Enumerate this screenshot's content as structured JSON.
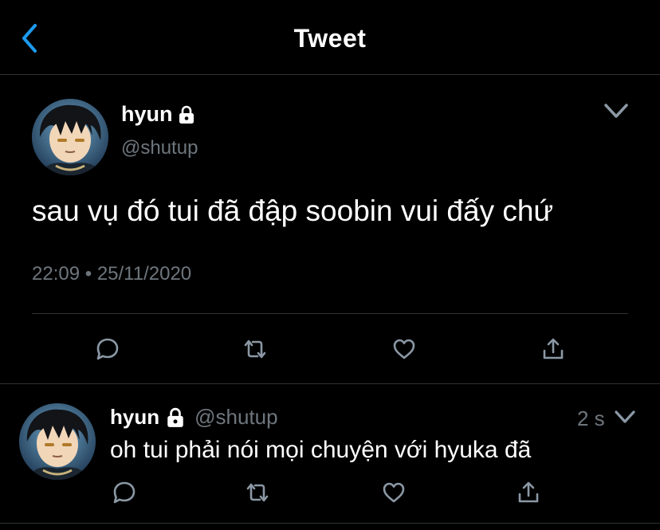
{
  "header": {
    "title": "Tweet",
    "back_icon": "chevron-left-icon",
    "accent_color": "#1d9bf0"
  },
  "tweet": {
    "display_name": "hyun",
    "handle": "@shutup",
    "locked": true,
    "text": "sau vụ đó tui đã đập soobin vui đấy chứ",
    "time": "22:09",
    "separator": "•",
    "date": "25/11/2020",
    "actions": [
      "reply-icon",
      "retweet-icon",
      "like-icon",
      "share-icon"
    ]
  },
  "reply": {
    "display_name": "hyun",
    "handle": "@shutup",
    "locked": true,
    "time_ago": "2 s",
    "text": "oh tui phải nói mọi chuyện với hyuka đã",
    "actions": [
      "reply-icon",
      "retweet-icon",
      "like-icon",
      "share-icon"
    ]
  },
  "colors": {
    "background": "#000000",
    "text": "#ffffff",
    "secondary_text": "#6e767d",
    "divider": "#2f3336"
  }
}
